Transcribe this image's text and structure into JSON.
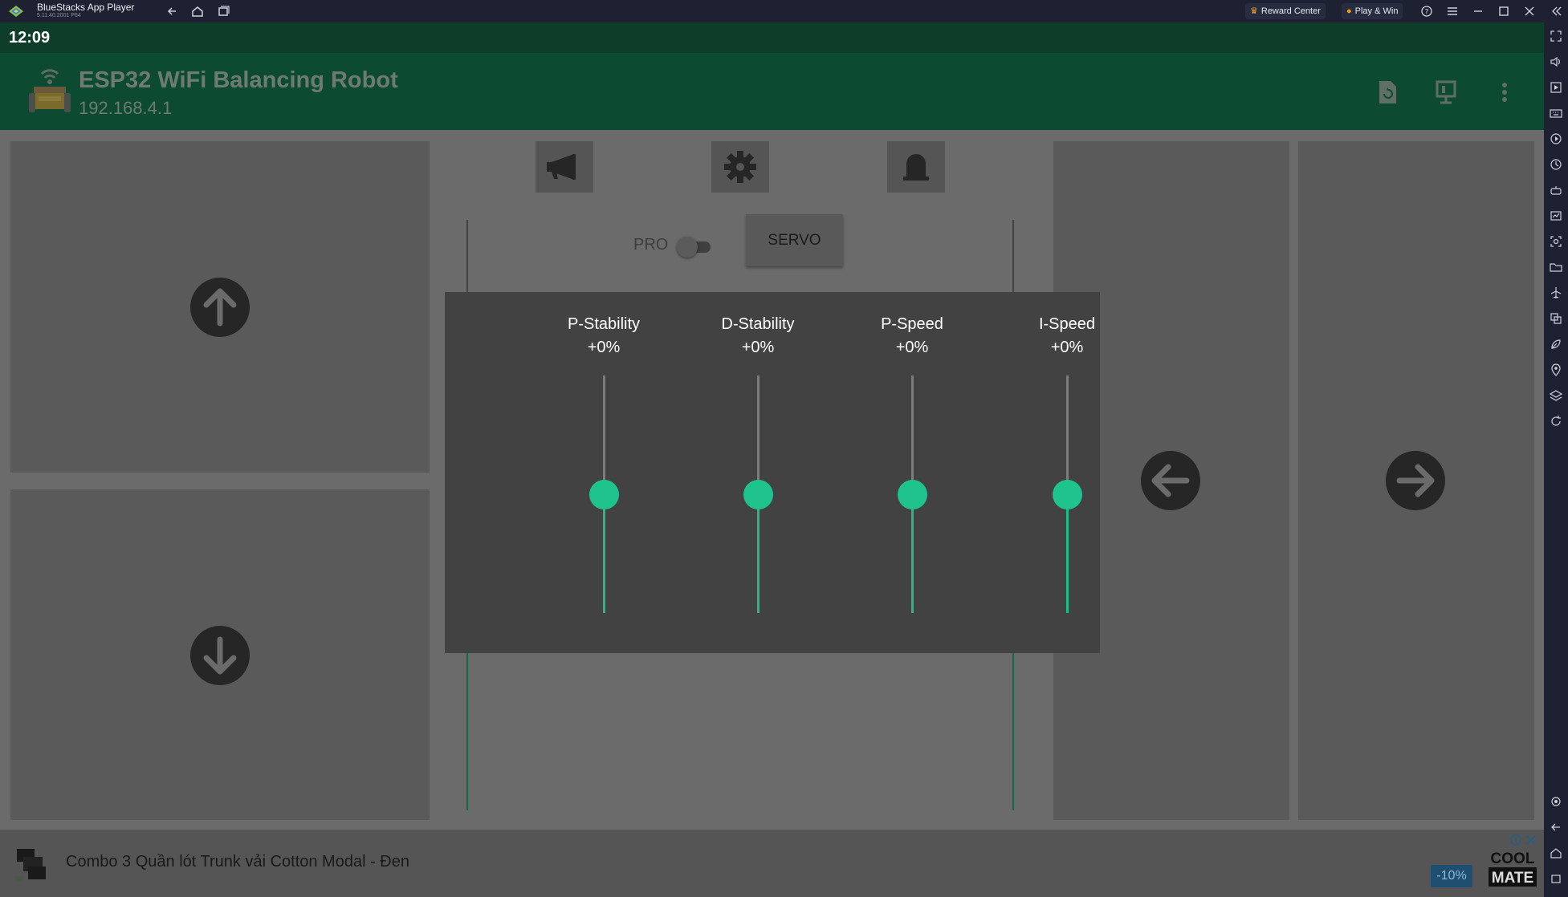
{
  "window": {
    "app_name": "BlueStacks App Player",
    "version": "5.11.40.2001 P64",
    "reward_center": "Reward Center",
    "play_win": "Play & Win"
  },
  "status": {
    "time": "12:09"
  },
  "appbar": {
    "title": "ESP32 WiFi Balancing Robot",
    "subtitle": "192.168.4.1",
    "icons": [
      "file-refresh-icon",
      "presentation-icon",
      "more-vertical-icon"
    ]
  },
  "controls": {
    "pro_label": "PRO",
    "pro_toggle_on": false,
    "servo_label": "SERVO",
    "top_icons": [
      "horn-icon",
      "gear-icon",
      "alarm-bell-icon"
    ],
    "direction_icons": [
      "arrow-up-icon",
      "arrow-down-icon",
      "arrow-left-icon",
      "arrow-right-icon"
    ]
  },
  "sliders": [
    {
      "label": "P-Stability",
      "value": "+0%",
      "level": 0.5
    },
    {
      "label": "D-Stability",
      "value": "+0%",
      "level": 0.5
    },
    {
      "label": "P-Speed",
      "value": "+0%",
      "level": 0.5
    },
    {
      "label": "I-Speed",
      "value": "+0%",
      "level": 0.5
    }
  ],
  "ad": {
    "text": "Combo 3 Quần lót Trunk vải Cotton Modal - Đen",
    "discount": "-10%",
    "brand": "COOL MATE"
  },
  "colors": {
    "accent": "#1fc38e",
    "appbar": "#0d4a32",
    "statusbar": "#0e3d2a",
    "background": "#6b6b6b",
    "overlay": "#424242"
  }
}
